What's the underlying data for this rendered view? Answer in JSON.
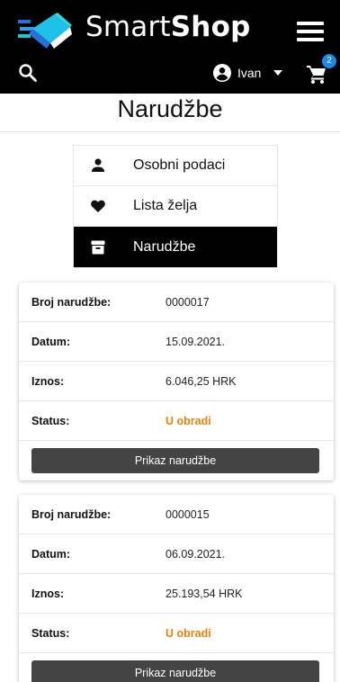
{
  "header": {
    "brand_light": "Smart",
    "brand_bold": "Shop",
    "user_name": "Ivan",
    "cart_count": "2",
    "icons": {
      "logo": "smartshop-logo-icon",
      "menu": "hamburger-menu-icon",
      "search": "search-icon",
      "user": "account-circle-icon",
      "caret": "caret-down-icon",
      "cart": "cart-icon"
    }
  },
  "page": {
    "title": "Narudžbe"
  },
  "menu": {
    "items": [
      {
        "label": "Osobni podaci",
        "icon": "person-icon"
      },
      {
        "label": "Lista želja",
        "icon": "heart-icon"
      },
      {
        "label": "Narudžbe",
        "icon": "archive-icon",
        "active": true
      }
    ]
  },
  "labels": {
    "order_number": "Broj narudžbe:",
    "date": "Datum:",
    "amount": "Iznos:",
    "status": "Status:",
    "view_button": "Prikaz narudžbe"
  },
  "orders": [
    {
      "number": "0000017",
      "date": "15.09.2021.",
      "amount": "6.046,25 HRK",
      "status": "U obradi"
    },
    {
      "number": "0000015",
      "date": "06.09.2021.",
      "amount": "25.193,54 HRK",
      "status": "U obradi"
    }
  ],
  "colors": {
    "header_bg": "#000000",
    "status": "#e8810b",
    "button": "#444444",
    "badge": "#1e88e5"
  }
}
